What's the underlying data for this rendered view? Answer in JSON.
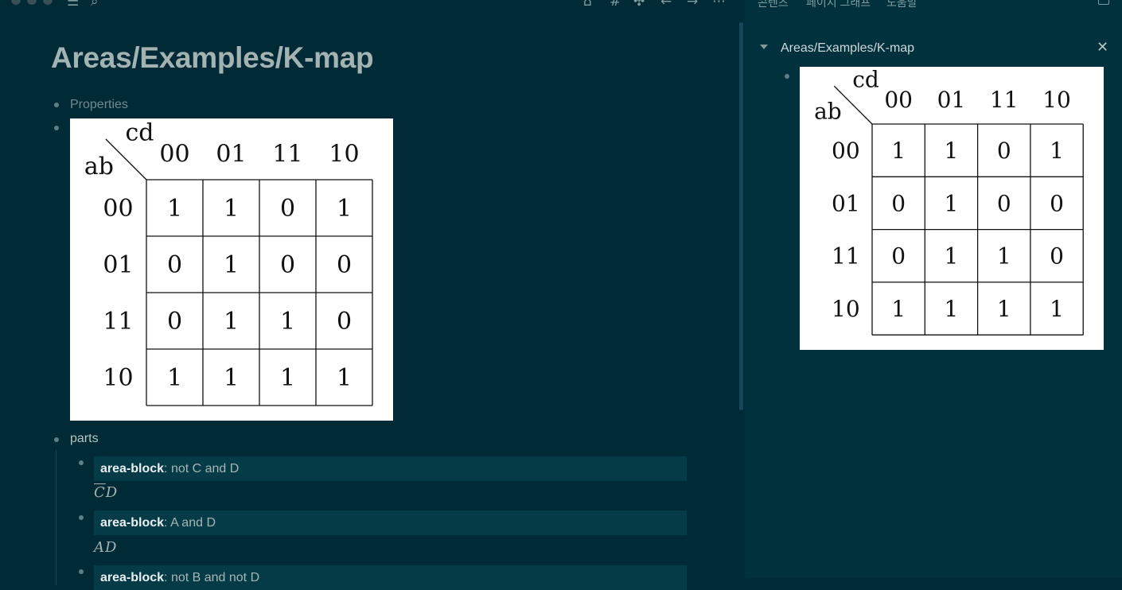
{
  "toolbar": {
    "menu_icon": "☰",
    "search_icon": "⌕",
    "home_icon": "⌂",
    "tag_icon": "#",
    "puzzle_icon": "✣",
    "back_icon": "←",
    "forward_icon": "→",
    "more_icon": "⋯"
  },
  "page": {
    "title": "Areas/Examples/K-map",
    "properties_label": "Properties",
    "parts_label": "parts",
    "blocks": [
      {
        "key": "area-block",
        "sep": ": ",
        "text": "not C and D",
        "math": "CD",
        "math_overline": "C"
      },
      {
        "key": "area-block",
        "sep": ": ",
        "text": "A and D",
        "math": "AD"
      },
      {
        "key": "area-block",
        "sep": ": ",
        "text": "not B and not D"
      }
    ]
  },
  "kmap": {
    "corner_top": "cd",
    "corner_left": "ab",
    "col_headers": [
      "00",
      "01",
      "11",
      "10"
    ],
    "row_headers": [
      "00",
      "01",
      "11",
      "10"
    ],
    "cells": [
      [
        "1",
        "1",
        "0",
        "1"
      ],
      [
        "0",
        "1",
        "0",
        "0"
      ],
      [
        "0",
        "1",
        "1",
        "0"
      ],
      [
        "1",
        "1",
        "1",
        "1"
      ]
    ]
  },
  "right_panel": {
    "tabs": [
      "콘텐츠",
      "페이지 그래프",
      "도움말"
    ],
    "title": "Areas/Examples/K-map",
    "close_icon": "✕"
  },
  "colors": {
    "background": "#002b36",
    "panel": "#00313d",
    "block": "#053a47",
    "text": "#93a1a1"
  }
}
